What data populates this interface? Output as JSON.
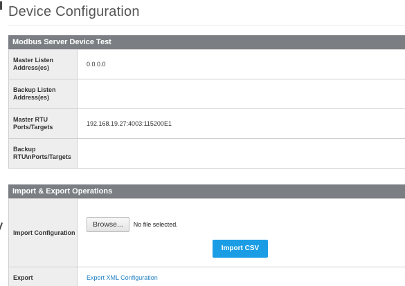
{
  "page": {
    "title": "Device Configuration"
  },
  "modbus_section": {
    "header": "Modbus Server Device Test",
    "rows": [
      {
        "label": "Master Listen Address(es)",
        "value": "0.0.0.0"
      },
      {
        "label": "Backup Listen Address(es)",
        "value": ""
      },
      {
        "label": "Master RTU Ports/Targets",
        "value": "192.168.19.27:4003:115200E1"
      },
      {
        "label": "Backup RTU\\nPorts/Targets",
        "value": ""
      }
    ]
  },
  "import_export": {
    "header": "Import & Export Operations",
    "import_label": "Import Configuration",
    "browse_label": "Browse...",
    "file_status": "No file selected.",
    "import_button": "Import CSV",
    "export_label": "Export",
    "export_link": "Export XML Configuration"
  },
  "colors": {
    "section_header_bg": "#7b7f83",
    "label_bg": "#eeeeee",
    "primary_button": "#1b9de6",
    "link": "#1f7fc3"
  }
}
